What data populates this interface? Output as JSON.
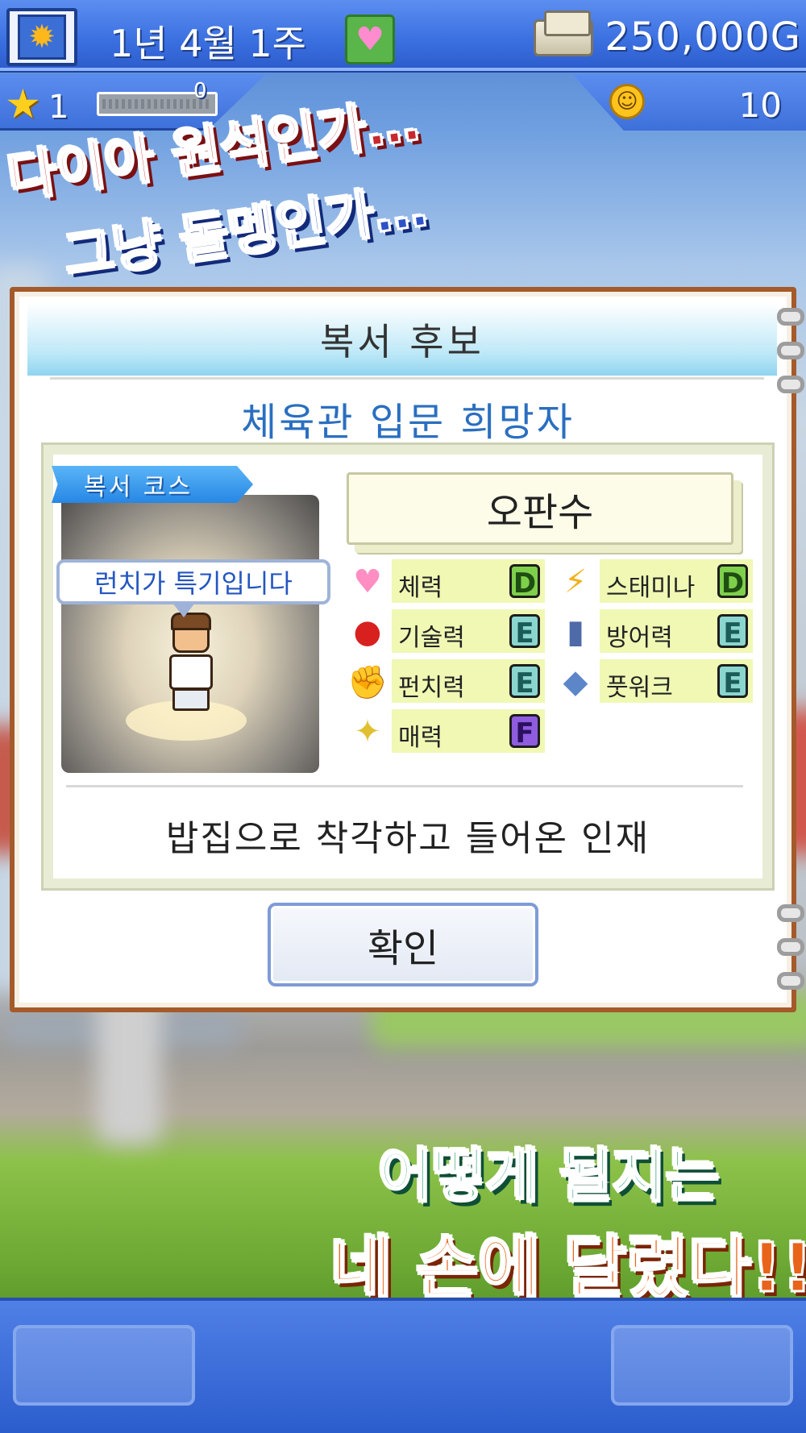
{
  "hud": {
    "date": "1년 4월 1주",
    "money": "250,000G",
    "rank_count": "1",
    "xp_value": "0",
    "happiness": "10"
  },
  "promo": {
    "line1": "다이아 원석인가…",
    "line2": "그냥 돌멩인가…",
    "line3": "어떻게 될지는",
    "line4": "네 손에 달렸다!!"
  },
  "dialog": {
    "title": "복서 후보",
    "subtitle": "체육관 입문 희망자",
    "course_tag": "복서 코스",
    "speech": "런치가 특기입니다",
    "name": "오판수",
    "stats": [
      {
        "label": "체력",
        "grade": "D",
        "icon": "heart-icon"
      },
      {
        "label": "스태미나",
        "grade": "D",
        "icon": "lightning-icon"
      },
      {
        "label": "기술력",
        "grade": "E",
        "icon": "boxing-glove-icon"
      },
      {
        "label": "방어력",
        "grade": "E",
        "icon": "armor-icon"
      },
      {
        "label": "펀치력",
        "grade": "E",
        "icon": "muscle-arm-icon"
      },
      {
        "label": "풋워크",
        "grade": "E",
        "icon": "shoe-icon"
      },
      {
        "label": "매력",
        "grade": "F",
        "icon": "sparkle-icon"
      }
    ],
    "description": "밥집으로 착각하고 들어온 인재",
    "confirm_label": "확인"
  },
  "colors": {
    "hud_blue": "#3a6fe0",
    "title_blue": "#2a6fc0",
    "frame_brown": "#a45a2a",
    "grade_D": "#7ed04a",
    "grade_E": "#8ad6cf",
    "grade_F": "#8f5ce0"
  }
}
